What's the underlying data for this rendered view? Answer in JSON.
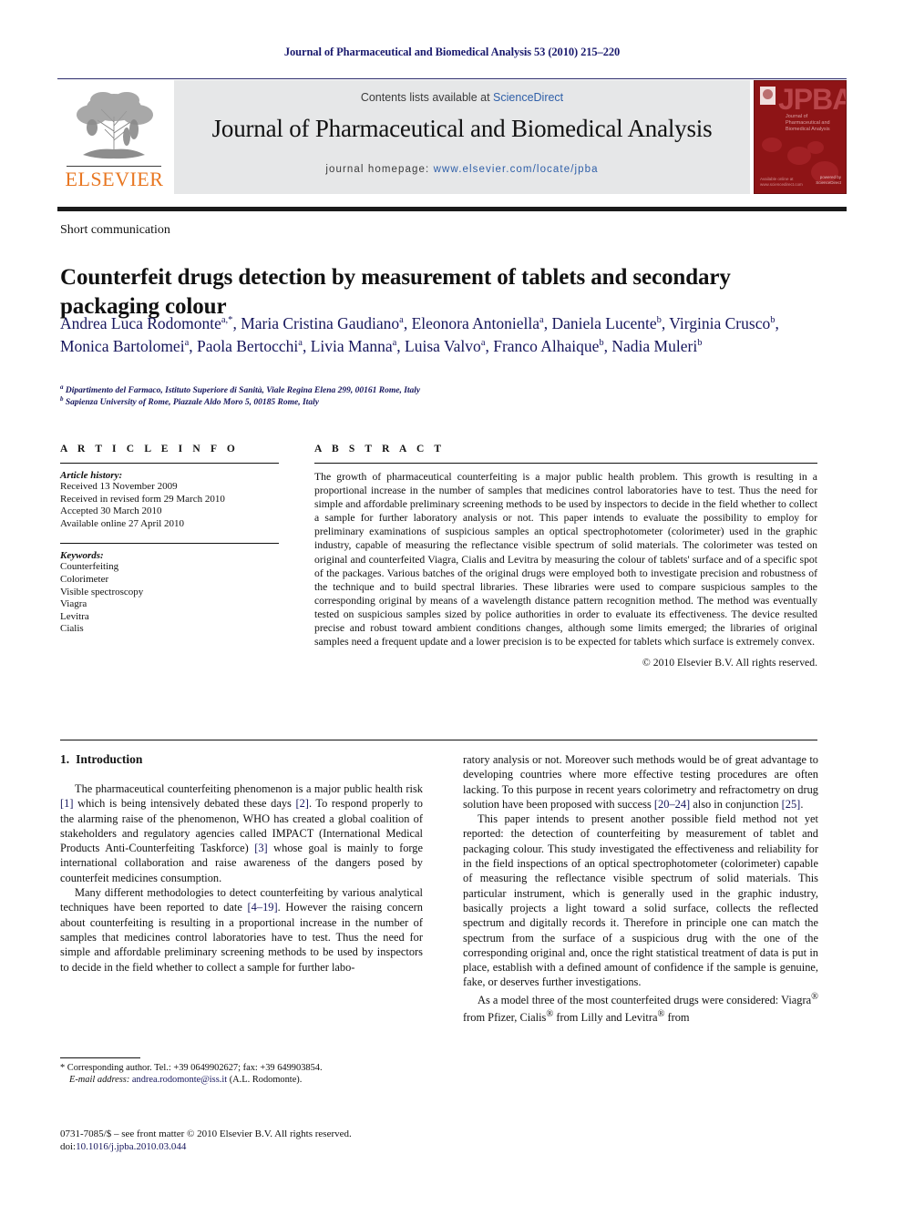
{
  "running_head": "Journal of Pharmaceutical and Biomedical Analysis 53 (2010) 215–220",
  "masthead": {
    "publisher_name": "ELSEVIER",
    "contents_prefix": "Contents lists available at",
    "contents_link": "ScienceDirect",
    "journal_title": "Journal of Pharmaceutical and Biomedical Analysis",
    "homepage_prefix": "journal homepage:",
    "homepage_url": "www.elsevier.com/locate/jpba",
    "cover": {
      "acronym": "JPBA",
      "subtitle": "Journal of Pharmaceutical and Biomedical Analysis",
      "footer_left": "Available online at www.sciencedirect.com",
      "footer_right": "powered by ScienceDirect"
    }
  },
  "article": {
    "type": "Short communication",
    "title": "Counterfeit drugs detection by measurement of tablets and secondary packaging colour",
    "authors_html": "Andrea Luca Rodomonte<sup>a,*</sup>, Maria Cristina Gaudiano<sup>a</sup>, Eleonora Antoniella<sup>a</sup>, Daniela Lucente<sup>b</sup>, Virginia Crusco<sup>b</sup>, Monica Bartolomei<sup>a</sup>, Paola Bertocchi<sup>a</sup>, Livia Manna<sup>a</sup>, Luisa Valvo<sup>a</sup>, Franco Alhaique<sup>b</sup>, Nadia Muleri<sup>b</sup>",
    "affiliation_a": "Dipartimento del Farmaco, Istituto Superiore di Sanità, Viale Regina Elena 299, 00161 Rome, Italy",
    "affiliation_b": "Sapienza University of Rome, Piazzale Aldo Moro 5, 00185 Rome, Italy"
  },
  "article_info": {
    "heading": "A R T I C L E   I N F O",
    "history_label": "Article history:",
    "history": [
      "Received 13 November 2009",
      "Received in revised form 29 March 2010",
      "Accepted 30 March 2010",
      "Available online 27 April 2010"
    ],
    "keywords_label": "Keywords:",
    "keywords": [
      "Counterfeiting",
      "Colorimeter",
      "Visible spectroscopy",
      "Viagra",
      "Levitra",
      "Cialis"
    ]
  },
  "abstract": {
    "heading": "A B S T R A C T",
    "text": "The growth of pharmaceutical counterfeiting is a major public health problem. This growth is resulting in a proportional increase in the number of samples that medicines control laboratories have to test. Thus the need for simple and affordable preliminary screening methods to be used by inspectors to decide in the field whether to collect a sample for further laboratory analysis or not. This paper intends to evaluate the possibility to employ for preliminary examinations of suspicious samples an optical spectrophotometer (colorimeter) used in the graphic industry, capable of measuring the reflectance visible spectrum of solid materials. The colorimeter was tested on original and counterfeited Viagra, Cialis and Levitra by measuring the colour of tablets' surface and of a specific spot of the packages. Various batches of the original drugs were employed both to investigate precision and robustness of the technique and to build spectral libraries. These libraries were used to compare suspicious samples to the corresponding original by means of a wavelength distance pattern recognition method. The method was eventually tested on suspicious samples sized by police authorities in order to evaluate its effectiveness. The device resulted precise and robust toward ambient conditions changes, although some limits emerged; the libraries of original samples need a frequent update and a lower precision is to be expected for tablets which surface is extremely convex.",
    "copyright": "© 2010 Elsevier B.V. All rights reserved."
  },
  "body": {
    "section_number": "1.",
    "section_title": "Introduction",
    "left_paragraph_1_html": "The pharmaceutical counterfeiting phenomenon is a major public health risk <span class=\"ref\">[1]</span> which is being intensively debated these days <span class=\"ref\">[2]</span>. To respond properly to the alarming raise of the phenomenon, WHO has created a global coalition of stakeholders and regulatory agencies called IMPACT (International Medical Products Anti-Counterfeiting Taskforce) <span class=\"ref\">[3]</span> whose goal is mainly to forge international collaboration and raise awareness of the dangers posed by counterfeit medicines consumption.",
    "left_paragraph_2_html": "Many different methodologies to detect counterfeiting by various analytical techniques have been reported to date <span class=\"ref\">[4–19]</span>. However the raising concern about counterfeiting is resulting in a proportional increase in the number of samples that medicines control laboratories have to test. Thus the need for simple and affordable preliminary screening methods to be used by inspectors to decide in the field whether to collect a sample for further labo-",
    "right_paragraph_1_html": "ratory analysis or not. Moreover such methods would be of great advantage to developing countries where more effective testing procedures are often lacking. To this purpose in recent years colorimetry and refractometry on drug solution have been proposed with success <span class=\"ref\">[20–24]</span> also in conjunction <span class=\"ref\">[25]</span>.",
    "right_paragraph_2_html": "This paper intends to present another possible field method not yet reported: the detection of counterfeiting by measurement of tablet and packaging colour. This study investigated the effectiveness and reliability for in the field inspections of an optical spectrophotometer (colorimeter) capable of measuring the reflectance visible spectrum of solid materials. This particular instrument, which is generally used in the graphic industry, basically projects a light toward a solid surface, collects the reflected spectrum and digitally records it. Therefore in principle one can match the spectrum from the surface of a suspicious drug with the one of the corresponding original and, once the right statistical treatment of data is put in place, establish with a defined amount of confidence if the sample is genuine, fake, or deserves further investigations.",
    "right_paragraph_3_html": "As a model three of the most counterfeited drugs were considered: Viagra<sup>®</sup> from Pfizer, Cialis<sup>®</sup> from Lilly and Levitra<sup>®</sup> from"
  },
  "footnote": {
    "corresponding_html": "* Corresponding author. Tel.: +39 0649902627; fax: +39 649903854.",
    "email_label": "E-mail address:",
    "email": "andrea.rodomonte@iss.it",
    "email_suffix": "(A.L. Rodomonte)."
  },
  "colophon": {
    "line1": "0731-7085/$ – see front matter © 2010 Elsevier B.V. All rights reserved.",
    "doi_label": "doi:",
    "doi": "10.1016/j.jpba.2010.03.044"
  },
  "colors": {
    "link_blue": "#2f5fa8",
    "author_navy": "#16165c",
    "elsevier_orange": "#e87722",
    "masthead_gray": "#e6e7e8",
    "cover_red": "#8e1416"
  }
}
